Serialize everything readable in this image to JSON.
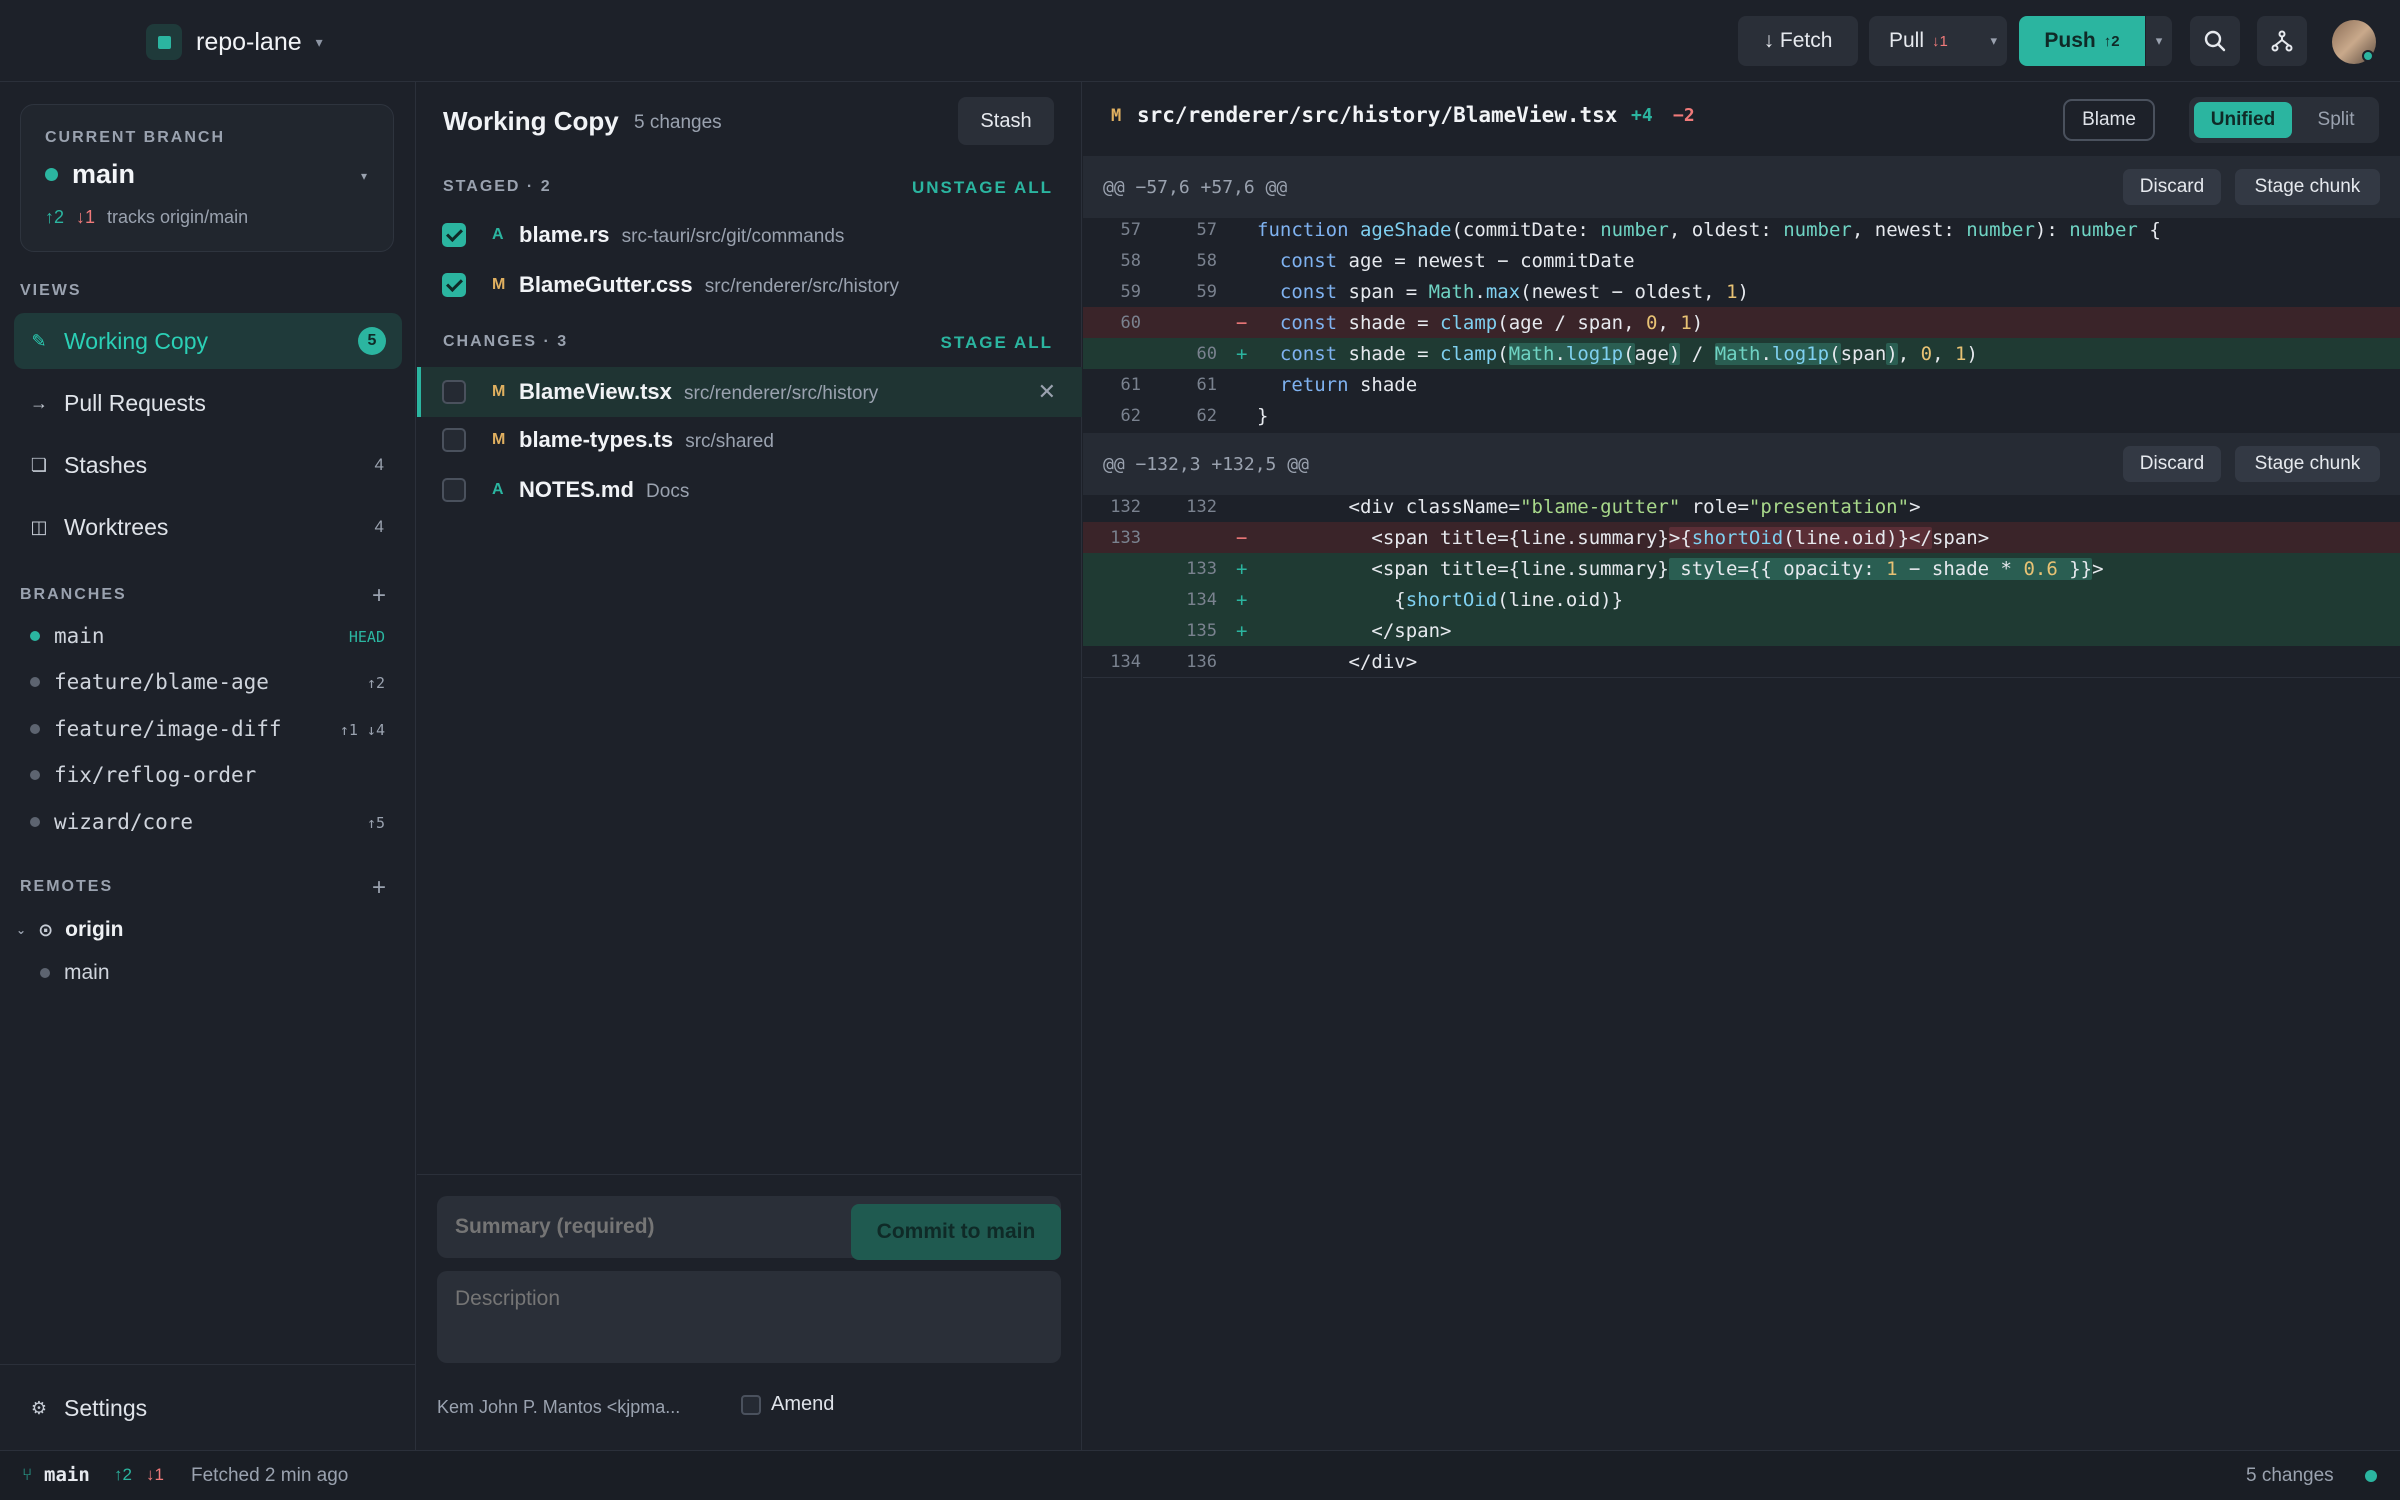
{
  "header": {
    "repo_name": "repo-lane",
    "fetch_label": "↓ Fetch",
    "pull_label": "Pull",
    "pull_count": "↓1",
    "push_label": "Push",
    "push_count": "↑2"
  },
  "sidebar": {
    "current_branch_label": "CURRENT BRANCH",
    "current_branch": "main",
    "ahead": "↑2",
    "behind": "↓1",
    "tracks": "tracks origin/main",
    "views_label": "VIEWS",
    "views": [
      {
        "label": "Working Copy",
        "count": "5",
        "icon": "pencil-icon"
      },
      {
        "label": "Pull Requests",
        "count": "",
        "icon": "arrow-right-icon"
      },
      {
        "label": "Stashes",
        "count": "4",
        "icon": "stash-icon"
      },
      {
        "label": "Worktrees",
        "count": "4",
        "icon": "worktree-icon"
      }
    ],
    "branches_label": "BRANCHES",
    "branches": [
      {
        "name": "main",
        "meta": "HEAD",
        "current": true
      },
      {
        "name": "feature/blame-age",
        "meta": "↑2"
      },
      {
        "name": "feature/image-diff",
        "meta": "↑1 ↓4"
      },
      {
        "name": "fix/reflog-order",
        "meta": ""
      },
      {
        "name": "wizard/core",
        "meta": "↑5"
      }
    ],
    "remotes_label": "REMOTES",
    "remote_name": "origin",
    "remote_branch": "main",
    "settings_label": "Settings"
  },
  "working": {
    "title": "Working Copy",
    "changes_count": "5 changes",
    "stash_label": "Stash",
    "staged_label": "STAGED · 2",
    "unstage_all": "UNSTAGE ALL",
    "staged": [
      {
        "status": "A",
        "name": "blame.rs",
        "path": "src-tauri/src/git/commands"
      },
      {
        "status": "M",
        "name": "BlameGutter.css",
        "path": "src/renderer/src/history"
      }
    ],
    "changes_label": "CHANGES · 3",
    "stage_all": "STAGE ALL",
    "changes": [
      {
        "status": "M",
        "name": "BlameView.tsx",
        "path": "src/renderer/src/history"
      },
      {
        "status": "M",
        "name": "blame-types.ts",
        "path": "src/shared"
      },
      {
        "status": "A",
        "name": "NOTES.md",
        "path": "Docs"
      }
    ],
    "summary_placeholder": "Summary (required)",
    "description_placeholder": "Description",
    "author": "Kem John P. Mantos <kjpma...",
    "amend_label": "Amend",
    "commit_label": "Commit to main"
  },
  "diff": {
    "status": "M",
    "file": "src/renderer/src/history/BlameView.tsx",
    "added": "+4",
    "removed": "−2",
    "blame_label": "Blame",
    "unified_label": "Unified",
    "split_label": "Split",
    "discard_label": "Discard",
    "stage_chunk_label": "Stage chunk",
    "hunk1_header": "@@ −57,6 +57,6 @@",
    "hunk2_header": "@@ −132,3 +132,5 @@"
  },
  "status_bar": {
    "branch": "main",
    "ahead": "↑2",
    "behind": "↓1",
    "fetched": "Fetched 2 min ago",
    "changes": "5 changes"
  },
  "colors": {
    "accent": "#2bb5a0",
    "added": "#2bb5a0",
    "deleted": "#f07a7a",
    "modified": "#e0b060"
  }
}
